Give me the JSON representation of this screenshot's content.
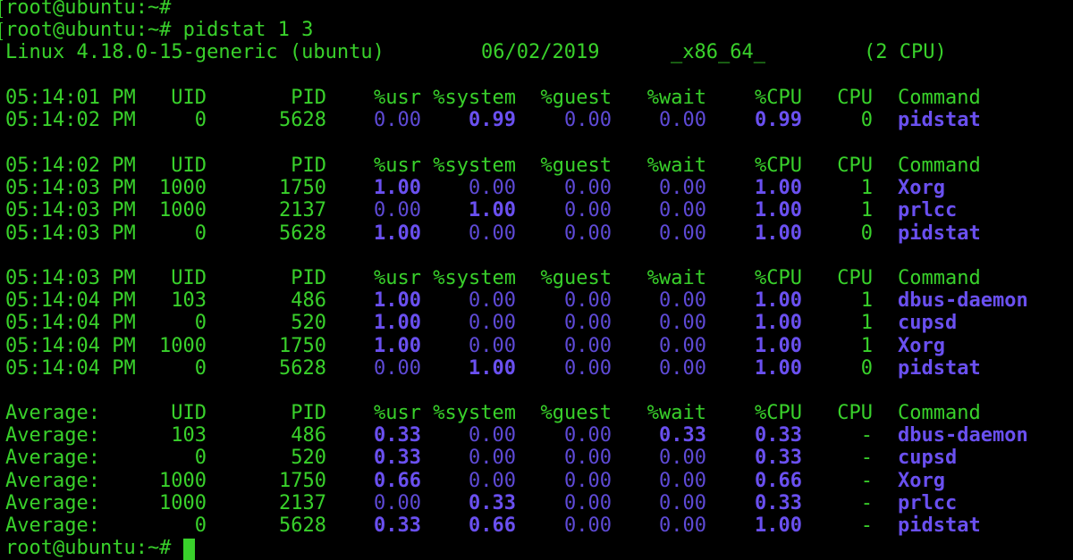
{
  "prompt_top": "root@ubuntu:~#",
  "command_line": "root@ubuntu:~# pidstat 1 3",
  "sysinfo": {
    "kernel": "Linux 4.18.0-15-generic (ubuntu)",
    "date": "06/02/2019",
    "arch": "_x86_64_",
    "cpus": "(2 CPU)"
  },
  "columns": [
    "UID",
    "PID",
    "%usr",
    "%system",
    "%guest",
    "%wait",
    "%CPU",
    "CPU",
    "Command"
  ],
  "blocks": [
    {
      "header_time": "05:14:01 PM",
      "rows": [
        {
          "time": "05:14:02 PM",
          "uid": "0",
          "pid": "5628",
          "usr": "0.00",
          "system": "0.99",
          "guest": "0.00",
          "wait": "0.00",
          "cpu_pct": "0.99",
          "cpu": "0",
          "command": "pidstat"
        }
      ]
    },
    {
      "header_time": "05:14:02 PM",
      "rows": [
        {
          "time": "05:14:03 PM",
          "uid": "1000",
          "pid": "1750",
          "usr": "1.00",
          "system": "0.00",
          "guest": "0.00",
          "wait": "0.00",
          "cpu_pct": "1.00",
          "cpu": "1",
          "command": "Xorg"
        },
        {
          "time": "05:14:03 PM",
          "uid": "1000",
          "pid": "2137",
          "usr": "0.00",
          "system": "1.00",
          "guest": "0.00",
          "wait": "0.00",
          "cpu_pct": "1.00",
          "cpu": "1",
          "command": "prlcc"
        },
        {
          "time": "05:14:03 PM",
          "uid": "0",
          "pid": "5628",
          "usr": "1.00",
          "system": "0.00",
          "guest": "0.00",
          "wait": "0.00",
          "cpu_pct": "1.00",
          "cpu": "0",
          "command": "pidstat"
        }
      ]
    },
    {
      "header_time": "05:14:03 PM",
      "rows": [
        {
          "time": "05:14:04 PM",
          "uid": "103",
          "pid": "486",
          "usr": "1.00",
          "system": "0.00",
          "guest": "0.00",
          "wait": "0.00",
          "cpu_pct": "1.00",
          "cpu": "1",
          "command": "dbus-daemon"
        },
        {
          "time": "05:14:04 PM",
          "uid": "0",
          "pid": "520",
          "usr": "1.00",
          "system": "0.00",
          "guest": "0.00",
          "wait": "0.00",
          "cpu_pct": "1.00",
          "cpu": "1",
          "command": "cupsd"
        },
        {
          "time": "05:14:04 PM",
          "uid": "1000",
          "pid": "1750",
          "usr": "1.00",
          "system": "0.00",
          "guest": "0.00",
          "wait": "0.00",
          "cpu_pct": "1.00",
          "cpu": "1",
          "command": "Xorg"
        },
        {
          "time": "05:14:04 PM",
          "uid": "0",
          "pid": "5628",
          "usr": "0.00",
          "system": "1.00",
          "guest": "0.00",
          "wait": "0.00",
          "cpu_pct": "1.00",
          "cpu": "0",
          "command": "pidstat"
        }
      ]
    },
    {
      "header_time": "Average:",
      "rows": [
        {
          "time": "Average:",
          "uid": "103",
          "pid": "486",
          "usr": "0.33",
          "system": "0.00",
          "guest": "0.00",
          "wait": "0.33",
          "cpu_pct": "0.33",
          "cpu": "-",
          "command": "dbus-daemon"
        },
        {
          "time": "Average:",
          "uid": "0",
          "pid": "520",
          "usr": "0.33",
          "system": "0.00",
          "guest": "0.00",
          "wait": "0.00",
          "cpu_pct": "0.33",
          "cpu": "-",
          "command": "cupsd"
        },
        {
          "time": "Average:",
          "uid": "1000",
          "pid": "1750",
          "usr": "0.66",
          "system": "0.00",
          "guest": "0.00",
          "wait": "0.00",
          "cpu_pct": "0.66",
          "cpu": "-",
          "command": "Xorg"
        },
        {
          "time": "Average:",
          "uid": "1000",
          "pid": "2137",
          "usr": "0.00",
          "system": "0.33",
          "guest": "0.00",
          "wait": "0.00",
          "cpu_pct": "0.33",
          "cpu": "-",
          "command": "prlcc"
        },
        {
          "time": "Average:",
          "uid": "0",
          "pid": "5628",
          "usr": "0.33",
          "system": "0.66",
          "guest": "0.00",
          "wait": "0.00",
          "cpu_pct": "1.00",
          "cpu": "-",
          "command": "pidstat"
        }
      ]
    }
  ],
  "prompt_bottom": "root@ubuntu:~#",
  "colors": {
    "text_green": "#39d12b",
    "value_dim": "#5e4ad6",
    "value_bold": "#6a50f0",
    "background": "#000000"
  }
}
